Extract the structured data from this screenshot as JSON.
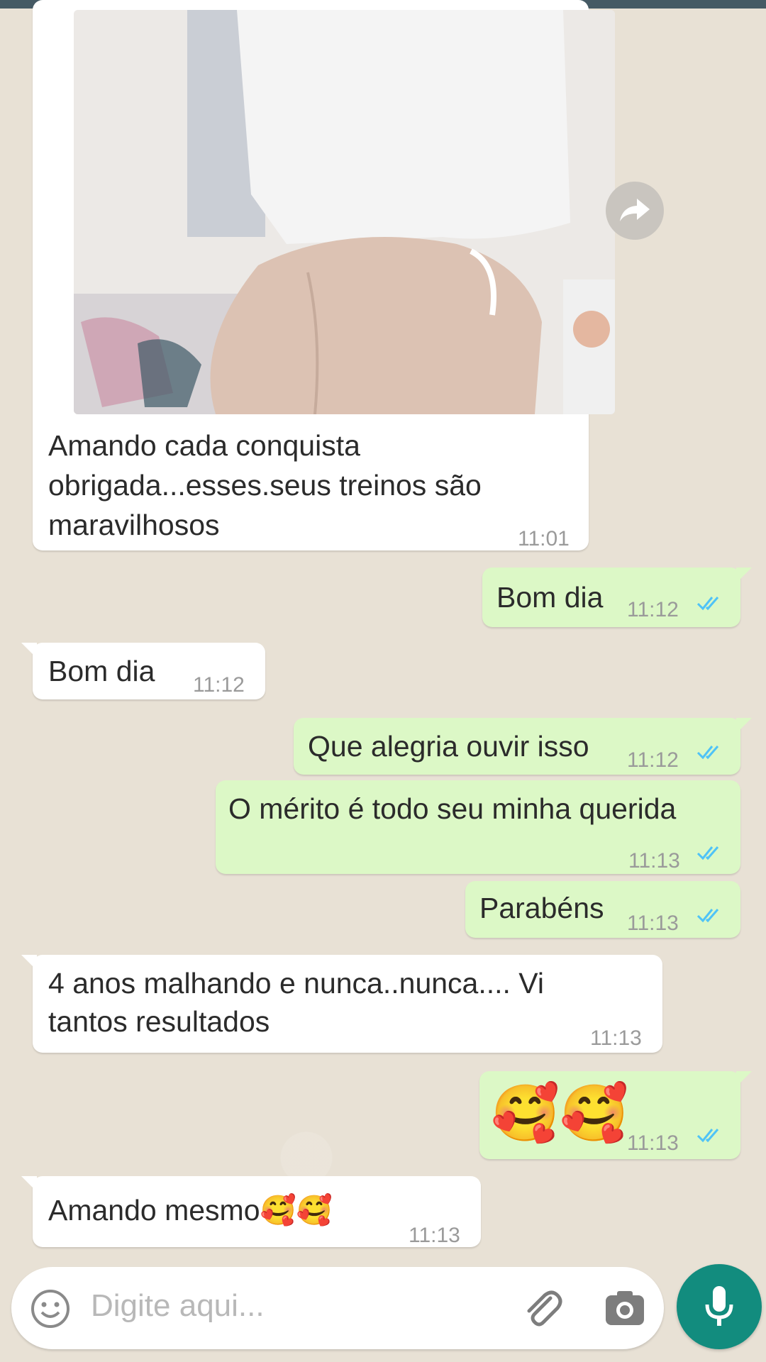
{
  "messages": [
    {
      "id": "m1",
      "direction": "in",
      "type": "image",
      "caption_lines": [
        "Amando cada conquista",
        "obrigada...esses.seus treinos são",
        "maravilhosos"
      ],
      "time": "11:01"
    },
    {
      "id": "m2",
      "direction": "out",
      "text": "Bom dia",
      "time": "11:12",
      "status": "read"
    },
    {
      "id": "m3",
      "direction": "in",
      "text": "Bom dia",
      "time": "11:12"
    },
    {
      "id": "m4",
      "direction": "out",
      "text": "Que alegria ouvir isso",
      "time": "11:12",
      "status": "read"
    },
    {
      "id": "m5",
      "direction": "out",
      "text": "O mérito é todo seu minha querida",
      "time": "11:13",
      "status": "read"
    },
    {
      "id": "m6",
      "direction": "out",
      "text": "Parabéns",
      "time": "11:13",
      "status": "read"
    },
    {
      "id": "m7",
      "direction": "in",
      "text_lines": [
        "4 anos malhando e nunca..nunca.... Vi",
        "tantos resultados"
      ],
      "time": "11:13"
    },
    {
      "id": "m8",
      "direction": "out",
      "text": "🥰🥰",
      "time": "11:13",
      "status": "read"
    },
    {
      "id": "m9",
      "direction": "in",
      "text": "Amando mesmo🥰🥰",
      "time": "11:13"
    }
  ],
  "input": {
    "placeholder": "Digite aqui..."
  },
  "icons": {
    "emoji": "emoji-icon",
    "attach": "paperclip-icon",
    "camera": "camera-icon",
    "mic": "microphone-icon",
    "forward": "forward-icon",
    "read_receipt": "double-check-icon"
  },
  "colors": {
    "incoming_bubble": "#ffffff",
    "outgoing_bubble": "#dcf8c6",
    "wallpaper": "#e8e1d5",
    "read_check": "#4fc3f7",
    "mic_button": "#128c7e",
    "top_bar": "#455a64"
  }
}
